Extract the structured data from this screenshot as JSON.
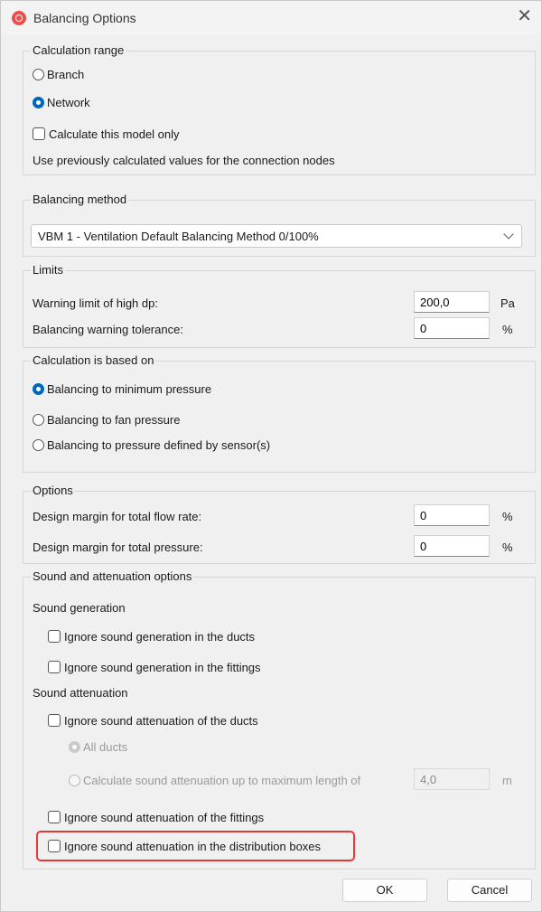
{
  "window": {
    "title": "Balancing Options",
    "close_glyph": "✕"
  },
  "calc_range": {
    "legend": "Calculation range",
    "branch": "Branch",
    "network": "Network",
    "model_only": "Calculate this model only",
    "note": "Use previously calculated values for the connection nodes"
  },
  "balancing_method": {
    "legend": "Balancing method",
    "selected": "VBM 1 - Ventilation Default Balancing Method 0/100%"
  },
  "limits": {
    "legend": "Limits",
    "high_dp_label": "Warning limit of high dp:",
    "high_dp_value": "200,0",
    "high_dp_unit": "Pa",
    "tolerance_label": "Balancing warning tolerance:",
    "tolerance_value": "0",
    "tolerance_unit": "%"
  },
  "calc_based": {
    "legend": "Calculation is based on",
    "min_pressure": "Balancing to minimum pressure",
    "fan_pressure": "Balancing to fan pressure",
    "sensor_pressure": "Balancing to pressure defined by sensor(s)"
  },
  "options": {
    "legend": "Options",
    "flow_label": "Design margin for total flow rate:",
    "flow_value": "0",
    "flow_unit": "%",
    "pressure_label": "Design margin for total pressure:",
    "pressure_value": "0",
    "pressure_unit": "%"
  },
  "sound": {
    "legend": "Sound and attenuation options",
    "generation_heading": "Sound generation",
    "gen_ducts": "Ignore sound generation in the ducts",
    "gen_fittings": "Ignore sound generation in the fittings",
    "attenuation_heading": "Sound attenuation",
    "att_ducts": "Ignore sound attenuation of the ducts",
    "all_ducts": "All ducts",
    "max_length": "Calculate sound attenuation up to maximum length of",
    "max_length_value": "4,0",
    "max_length_unit": "m",
    "att_fittings": "Ignore sound attenuation of the fittings",
    "att_boxes": "Ignore sound attenuation in the distribution boxes"
  },
  "buttons": {
    "ok": "OK",
    "cancel": "Cancel"
  },
  "colors": {
    "accent": "#0067c0",
    "highlight": "#e53935"
  }
}
